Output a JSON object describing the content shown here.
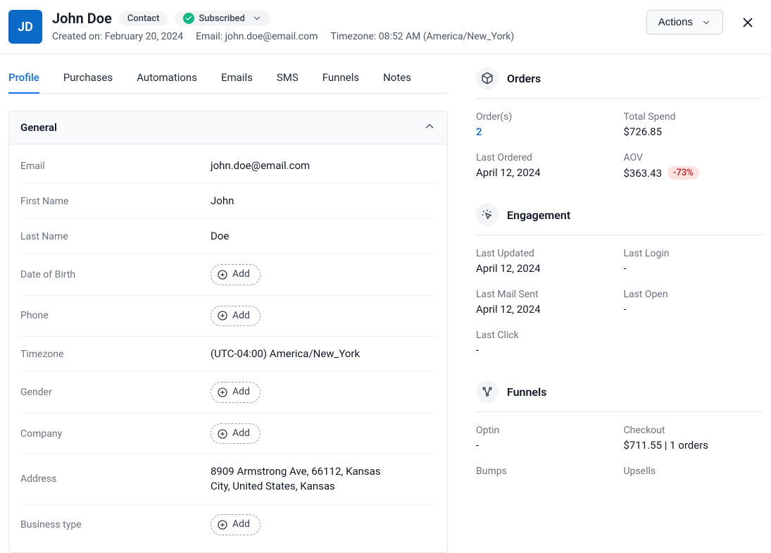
{
  "header": {
    "initials": "JD",
    "name": "John Doe",
    "type_badge": "Contact",
    "subscribe_badge": "Subscribed",
    "created_label": "Created on:",
    "created_value": "February 20, 2024",
    "email_label": "Email:",
    "email_value": "john.doe@email.com",
    "tz_label": "Timezone:",
    "tz_value": "08:52 AM (America/New_York)",
    "actions_label": "Actions"
  },
  "tabs": [
    "Profile",
    "Purchases",
    "Automations",
    "Emails",
    "SMS",
    "Funnels",
    "Notes"
  ],
  "panel": {
    "title": "General",
    "fields": {
      "email_label": "Email",
      "email_value": "john.doe@email.com",
      "fname_label": "First Name",
      "fname_value": "John",
      "lname_label": "Last Name",
      "lname_value": "Doe",
      "dob_label": "Date of Birth",
      "phone_label": "Phone",
      "tz_label": "Timezone",
      "tz_value": "(UTC-04:00) America/New_York",
      "gender_label": "Gender",
      "company_label": "Company",
      "address_label": "Address",
      "address_value": "8909 Armstrong Ave, 66112, Kansas City, United States, Kansas",
      "biztype_label": "Business type",
      "add_text": "Add"
    }
  },
  "orders": {
    "title": "Orders",
    "count_label": "Order(s)",
    "count_value": "2",
    "spend_label": "Total Spend",
    "spend_value": "$726.85",
    "last_ordered_label": "Last Ordered",
    "last_ordered_value": "April 12, 2024",
    "aov_label": "AOV",
    "aov_value": "$363.43",
    "aov_delta": "-73%"
  },
  "engagement": {
    "title": "Engagement",
    "last_updated_label": "Last Updated",
    "last_updated_value": "April 12, 2024",
    "last_login_label": "Last Login",
    "last_login_value": "-",
    "last_mail_label": "Last Mail Sent",
    "last_mail_value": "April 12, 2024",
    "last_open_label": "Last Open",
    "last_open_value": "-",
    "last_click_label": "Last Click",
    "last_click_value": "-"
  },
  "funnels": {
    "title": "Funnels",
    "optin_label": "Optin",
    "optin_value": "-",
    "checkout_label": "Checkout",
    "checkout_value": "$711.55 | 1 orders",
    "bumps_label": "Bumps",
    "upsells_label": "Upsells"
  }
}
